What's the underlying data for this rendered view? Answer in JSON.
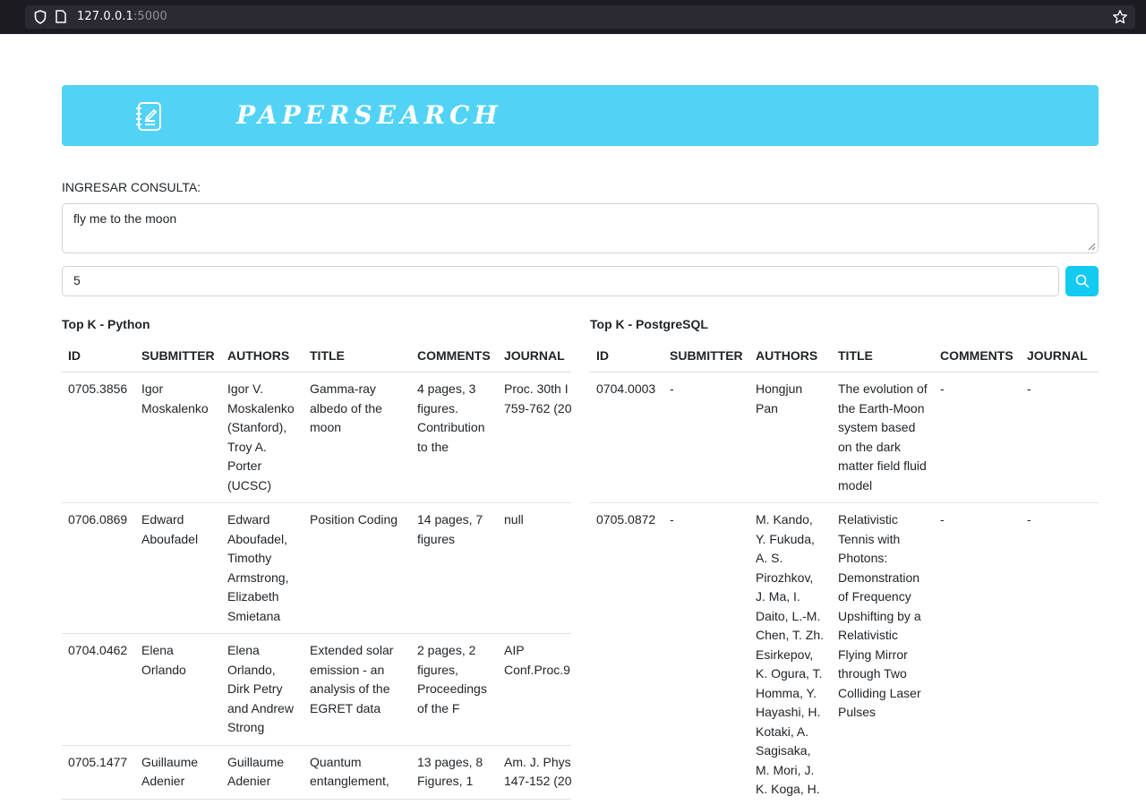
{
  "browser": {
    "url_host": "127.0.0.1",
    "url_port": ":5000"
  },
  "header": {
    "brand": "PAPERSEARCH"
  },
  "form": {
    "query_label": "INGRESAR CONSULTA:",
    "query_value": "fly me to the moon",
    "k_value": "5"
  },
  "python": {
    "title": "Top K - Python",
    "columns": [
      "ID",
      "SUBMITTER",
      "AUTHORS",
      "TITLE",
      "COMMENTS",
      "JOURNAL"
    ],
    "rows": [
      {
        "id": "0705.3856",
        "submitter": "Igor Moskalenko",
        "authors": "Igor V. Moskalenko (Stanford), Troy A. Porter (UCSC)",
        "title": "Gamma-ray albedo of the moon",
        "comments": "4 pages, 3 figures. Contribution to the",
        "journal": "Proc. 30th I",
        "journal2": "759-762 (20"
      },
      {
        "id": "0706.0869",
        "submitter": "Edward Aboufadel",
        "authors": "Edward Aboufadel, Timothy Armstrong, Elizabeth Smietana",
        "title": "Position Coding",
        "comments": "14 pages, 7 figures",
        "journal": "null",
        "journal2": ""
      },
      {
        "id": "0704.0462",
        "submitter": "Elena Orlando",
        "authors": "Elena Orlando, Dirk Petry and Andrew Strong",
        "title": "Extended solar emission - an analysis of the EGRET data",
        "comments": "2 pages, 2 figures, Proceedings of the F",
        "journal": "AIP",
        "journal2": "Conf.Proc.9"
      },
      {
        "id": "0705.1477",
        "submitter": "Guillaume Adenier",
        "authors": "Guillaume Adenier",
        "title": "Quantum entanglement,",
        "comments": "13 pages, 8 Figures, 1",
        "journal": "Am. J. Phys.",
        "journal2": "147-152 (20"
      }
    ]
  },
  "postgres": {
    "title": "Top K - PostgreSQL",
    "columns": [
      "ID",
      "SUBMITTER",
      "AUTHORS",
      "TITLE",
      "COMMENTS",
      "JOURNAL"
    ],
    "rows": [
      {
        "id": "0704.0003",
        "submitter": "-",
        "authors": "Hongjun Pan",
        "title": "The evolution of the Earth-Moon system based on the dark matter field fluid model",
        "comments": "-",
        "journal": "-"
      },
      {
        "id": "0705.0872",
        "submitter": "-",
        "authors": "M. Kando, Y. Fukuda, A. S. Pirozhkov, J. Ma, I. Daito, L.-M. Chen, T. Zh. Esirkepov, K. Ogura, T. Homma, Y. Hayashi, H. Kotaki, A. Sagisaka, M. Mori, J. K. Koga, H.",
        "title": "Relativistic Tennis with Photons: Demonstration of Frequency Upshifting by a Relativistic Flying Mirror through Two Colliding Laser Pulses",
        "comments": "-",
        "journal": "-"
      }
    ]
  },
  "colors": {
    "banner": "#52d3f6",
    "button": "#13caf0",
    "browser_bar": "#1c1b22"
  },
  "icons": [
    "shield-icon",
    "page-icon",
    "star-icon",
    "notebook-icon",
    "search-icon"
  ]
}
